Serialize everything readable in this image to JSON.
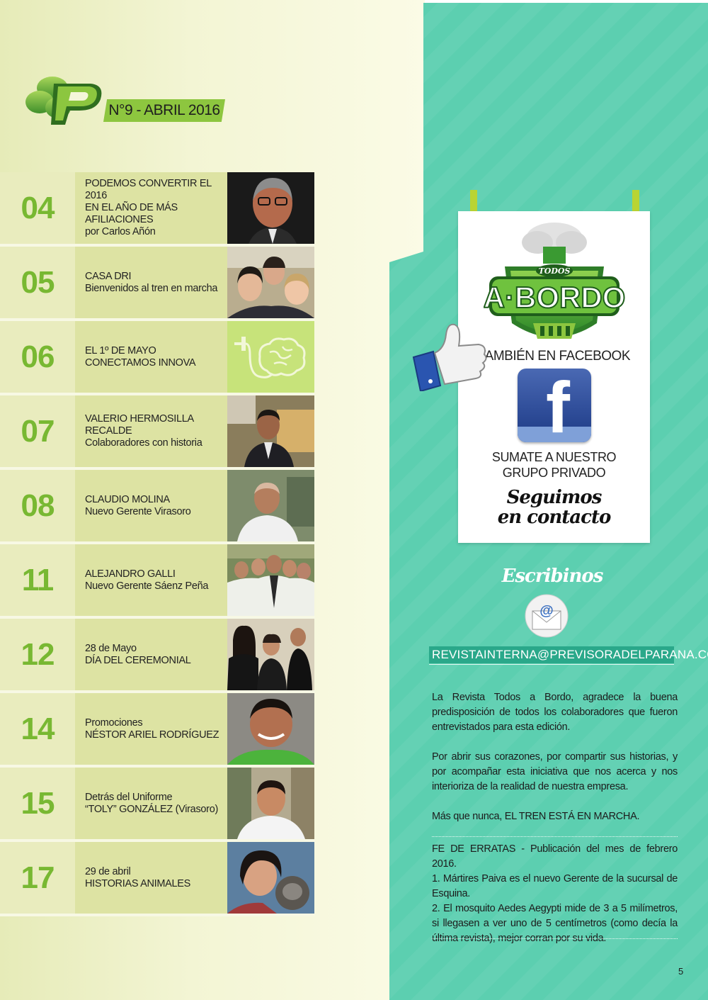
{
  "header": {
    "logo_letter": "P",
    "issue": "N°9 - ABRIL 2016"
  },
  "toc": [
    {
      "num": "04",
      "lines": [
        "PODEMOS CONVERTIR EL 2016",
        "EN EL AÑO DE MÁS AFILIACIONES",
        "por Carlos Añón"
      ]
    },
    {
      "num": "05",
      "lines": [
        "CASA DRI",
        "Bienvenidos al tren en marcha"
      ]
    },
    {
      "num": "06",
      "lines": [
        "EL 1º DE MAYO",
        "CONECTAMOS INNOVA"
      ]
    },
    {
      "num": "07",
      "lines": [
        "VALERIO HERMOSILLA RECALDE",
        "Colaboradores con historia"
      ]
    },
    {
      "num": "08",
      "lines": [
        "CLAUDIO MOLINA",
        "Nuevo Gerente Virasoro"
      ]
    },
    {
      "num": "11",
      "lines": [
        "ALEJANDRO GALLI",
        "Nuevo Gerente Sáenz Peña"
      ]
    },
    {
      "num": "12",
      "lines": [
        "28 de Mayo",
        "DÍA DEL CEREMONIAL"
      ]
    },
    {
      "num": "14",
      "lines": [
        "Promociones",
        "NÉSTOR ARIEL RODRÍGUEZ"
      ]
    },
    {
      "num": "15",
      "lines": [
        "Detrás del Uniforme",
        "“TOLY” GONZÁLEZ (Virasoro)"
      ]
    },
    {
      "num": "17",
      "lines": [
        "29 de abril",
        "HISTORIAS ANIMALES"
      ]
    }
  ],
  "poster": {
    "logo_small": "TODOS",
    "logo_big": "A·BORDO",
    "facebook_line": "TAMBIÉN EN FACEBOOK",
    "fb_letter": "f",
    "group_line1": "SUMATE A NUESTRO",
    "group_line2": "GRUPO PRIVADO",
    "seguimos_line1": "Seguimos",
    "seguimos_line2": "en contacto"
  },
  "contact": {
    "title": "Escribinos",
    "mail_symbol": "@",
    "email": "REVISTAINTERNA@PREVISORADELPARANA.COM"
  },
  "body": {
    "p1": "La Revista Todos a Bordo, agradece la buena predisposición de todos los colaboradores que fueron entrevistados para esta edición.",
    "p2": "Por abrir sus corazones, por compartir sus historias, y por acompañar esta iniciativa que nos acerca y nos interioriza de la realidad de nuestra empresa.",
    "p3": "Más que nunca, EL TREN ESTÁ EN MARCHA.",
    "errata": "FE DE ERRATAS - Publicación del mes de febrero 2016.\n1. Mártires Paiva es el nuevo Gerente de la sucursal de Esquina.\n2. El mosquito Aedes Aegypti mide de 3 a 5 milímetros, si llegasen a ver uno de 5 centímetros (como decía la última revista), mejor corran por su vida."
  },
  "page_number": "5"
}
